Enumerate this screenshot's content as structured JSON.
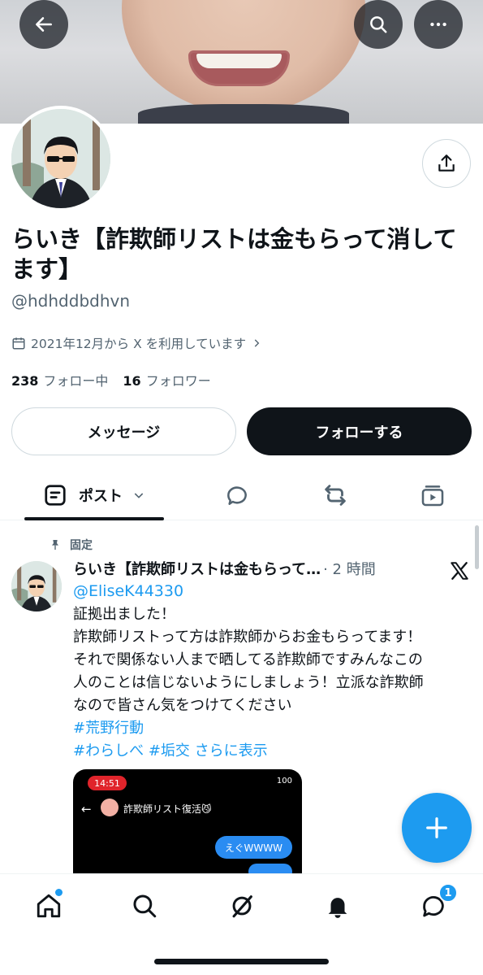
{
  "profile": {
    "display_name": "らいき【詐欺師リストは金もらって消してます】",
    "handle": "@hdhddbdhvn",
    "joined": "2021年12月から X を利用しています",
    "following_count": "238",
    "following_label": "フォロー中",
    "followers_count": "16",
    "followers_label": "フォロワー"
  },
  "actions": {
    "message": "メッセージ",
    "follow": "フォローする"
  },
  "tabs": {
    "posts_label": "ポスト"
  },
  "post": {
    "pinned_label": "固定",
    "author": "らいき【詐欺師リストは金もらって…",
    "time": "· 2 時間",
    "mention": "@EliseK44330",
    "lines": [
      "証拠出ました！",
      "詐欺師リストって方は詐欺師からお金もらってます！",
      "それで関係ない人まで晒してる詐欺師ですみんなこの",
      "人のことは信じないようにしましょう！立派な詐欺師",
      "なので皆さん気をつけてください"
    ],
    "hashtag1": "#荒野行動",
    "hashtag2": "#わらしべ",
    "hashtag3": "#垢交",
    "show_more": "さらに表示",
    "image": {
      "time": "14:51",
      "battery": "100",
      "chat_name": "詐欺師リスト復活😼",
      "bubble_text": "えぐWWWW"
    }
  },
  "nav": {
    "messages_badge": "1"
  },
  "colors": {
    "accent": "#1d9bf0",
    "text": "#0f1419",
    "muted": "#536471"
  }
}
